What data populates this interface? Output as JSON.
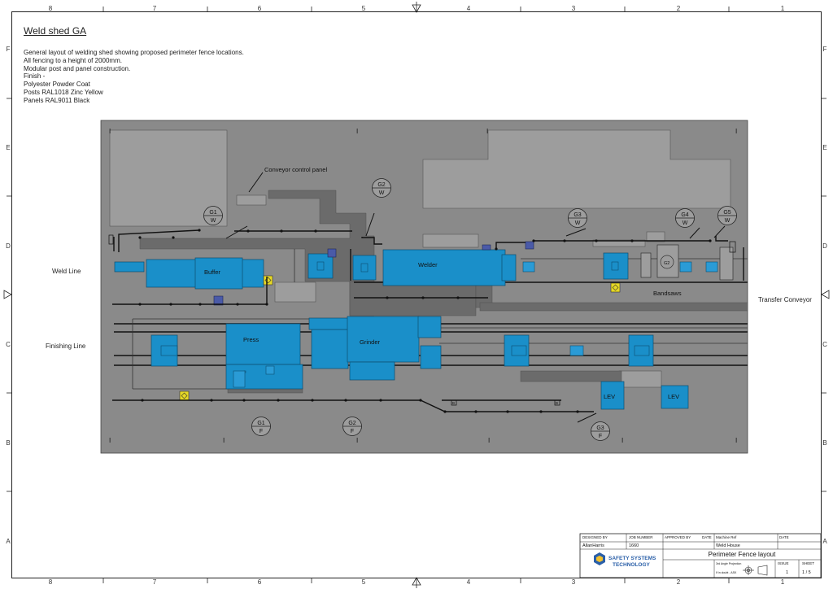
{
  "drawing": {
    "title": "Weld shed GA",
    "notes": [
      "General layout of welding shed showing proposed perimeter fence locations.",
      "All fencing to a height of 2000mm.",
      "Modular post and panel construction.",
      "Finish -",
      "Polyester Powder Coat",
      "Posts RAL1018 Zinc Yellow",
      "Panels RAL9011 Black"
    ],
    "colors": {
      "floor": "#8a8a8a",
      "machine": "#1a8fc9",
      "walkway": "#6b6b6b",
      "fence": "#111111",
      "marker": "#e6d825"
    }
  },
  "grid": {
    "columns": [
      "8",
      "7",
      "6",
      "5",
      "4",
      "3",
      "2",
      "1"
    ],
    "rows": [
      "F",
      "E",
      "D",
      "C",
      "B",
      "A"
    ]
  },
  "side_labels": {
    "weld_line": "Weld Line",
    "finishing_line": "Finishing Line",
    "transfer_conveyor": "Transfer Conveyor"
  },
  "plan": {
    "machines": {
      "buffer": "Buffer",
      "welder": "Welder",
      "press": "Press",
      "grinder": "Grinder",
      "lev1": "LEV",
      "lev2": "LEV",
      "bandsaws": "Bandsaws",
      "conveyor_panel": "Conveyor control panel",
      "g2_tag": "G2",
      "b1": "B",
      "b2": "B"
    },
    "gates": [
      {
        "id": "G1",
        "type": "W"
      },
      {
        "id": "G2",
        "type": "W"
      },
      {
        "id": "G3",
        "type": "W"
      },
      {
        "id": "G4",
        "type": "W"
      },
      {
        "id": "G5",
        "type": "W"
      },
      {
        "id": "G1",
        "type": "F"
      },
      {
        "id": "G2",
        "type": "F"
      },
      {
        "id": "G3",
        "type": "F"
      }
    ]
  },
  "title_block": {
    "designed_by_label": "DESIGNED BY",
    "designed_by": "AllanHarris",
    "job_number_label": "JOB NUMBER",
    "job_number": "1660",
    "approved_by_label": "APPROVED BY",
    "date_label": "DATE",
    "machine_ref_label": "Machine Ref",
    "machine_ref": "Weld House",
    "date2_label": "DATE",
    "drawing_title": "Perimeter Fence layout",
    "company_line1": "SAFETY SYSTEMS",
    "company_line2": "TECHNOLOGY",
    "projection_label": "3rd Angle Projection",
    "projection_note": "If in doubt - ASK",
    "issue_label": "ISSUE",
    "issue": "1",
    "sheet_label": "SHEET",
    "sheet": "1 / 5"
  }
}
